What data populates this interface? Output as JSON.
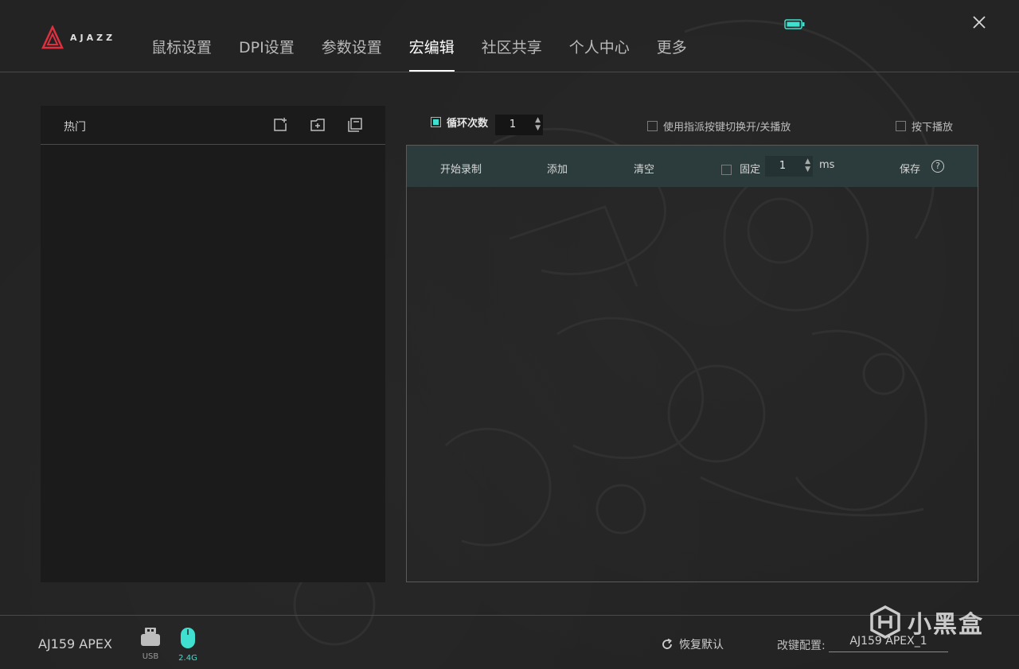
{
  "header": {
    "logo_text": "AJAZZ",
    "nav": [
      {
        "label": "鼠标设置",
        "active": false
      },
      {
        "label": "DPI设置",
        "active": false
      },
      {
        "label": "参数设置",
        "active": false
      },
      {
        "label": "宏编辑",
        "active": true
      },
      {
        "label": "社区共享",
        "active": false
      },
      {
        "label": "个人中心",
        "active": false
      },
      {
        "label": "更多",
        "active": false
      }
    ],
    "battery_icon": "battery-icon",
    "close_icon": "close-icon"
  },
  "left_panel": {
    "title": "热门",
    "tools": [
      "new-macro-icon",
      "new-folder-icon",
      "copy-icon"
    ]
  },
  "macro": {
    "loop_label": "循环次数",
    "loop_checked": true,
    "loop_count": "1",
    "assigned_key_toggle_label": "使用指派按键切换开/关播放",
    "press_play_label": "按下播放",
    "toolbar": {
      "record": "开始录制",
      "add": "添加",
      "clear": "清空",
      "fixed_label": "固定",
      "fixed_value": "1",
      "unit": "ms",
      "save": "保存",
      "help": "?"
    }
  },
  "footer": {
    "device_name": "AJ159 APEX",
    "usb_label": "USB",
    "wireless_label": "2.4G",
    "restore_label": "恢复默认",
    "profile_label": "改键配置:",
    "profile_value": "AJ159 APEX_1"
  },
  "watermark": "小黑盒",
  "colors": {
    "accent": "#3fe0d0",
    "logo_red": "#e03040",
    "toolbar_bg": "#2c3c3d"
  }
}
